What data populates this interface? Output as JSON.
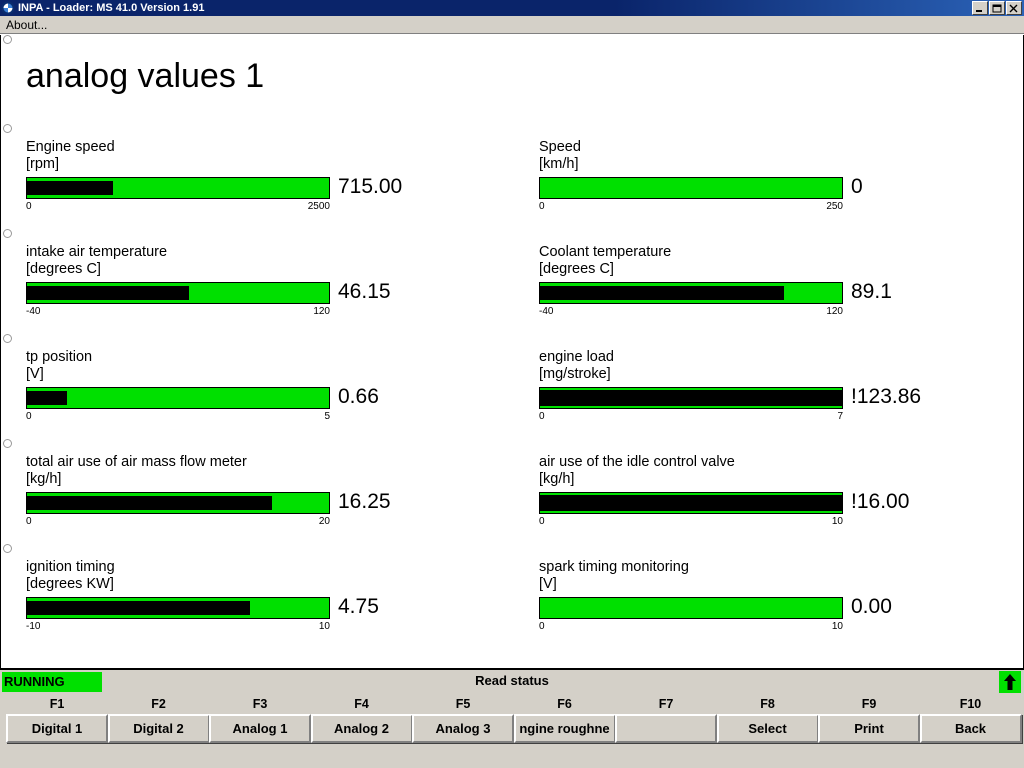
{
  "window": {
    "title": "INPA - Loader:  MS 41.0 Version 1.91",
    "icon": "bmw-roundel-icon",
    "minimize_label": "minimize-icon",
    "maximize_label": "maximize-icon",
    "close_label": "close-icon"
  },
  "menubar": {
    "items": [
      {
        "label": "About..."
      }
    ]
  },
  "page": {
    "title": "analog values 1"
  },
  "gauges": [
    {
      "name": "Engine speed",
      "unit": "[rpm]",
      "value": "715.00",
      "min_label": "0",
      "max_label": "2500",
      "min": 0,
      "max": 2500,
      "numeric": 715.0,
      "fill_percent": 28.6,
      "over_range": false
    },
    {
      "name": "Speed",
      "unit": "[km/h]",
      "value": "0",
      "min_label": "0",
      "max_label": "250",
      "min": 0,
      "max": 250,
      "numeric": 0,
      "fill_percent": 0,
      "over_range": false
    },
    {
      "name": "intake air temperature",
      "unit": "[degrees C]",
      "value": "46.15",
      "min_label": "-40",
      "max_label": "120",
      "min": -40,
      "max": 120,
      "numeric": 46.15,
      "fill_percent": 53.8,
      "over_range": false
    },
    {
      "name": "Coolant temperature",
      "unit": "[degrees C]",
      "value": "89.1",
      "min_label": "-40",
      "max_label": "120",
      "min": -40,
      "max": 120,
      "numeric": 89.1,
      "fill_percent": 80.7,
      "over_range": false
    },
    {
      "name": "tp position",
      "unit": "[V]",
      "value": "0.66",
      "min_label": "0",
      "max_label": "5",
      "min": 0,
      "max": 5,
      "numeric": 0.66,
      "fill_percent": 13.2,
      "over_range": false
    },
    {
      "name": "engine load",
      "unit": "[mg/stroke]",
      "value": "!123.86",
      "min_label": "0",
      "max_label": "7",
      "min": 0,
      "max": 7,
      "numeric": 123.86,
      "fill_percent": 100,
      "over_range": true
    },
    {
      "name": "total air use of air mass flow meter",
      "unit": "[kg/h]",
      "value": "16.25",
      "min_label": "0",
      "max_label": "20",
      "min": 0,
      "max": 20,
      "numeric": 16.25,
      "fill_percent": 81.2,
      "over_range": false
    },
    {
      "name": "air use of the idle control valve",
      "unit": "[kg/h]",
      "value": "!16.00",
      "min_label": "0",
      "max_label": "10",
      "min": 0,
      "max": 10,
      "numeric": 16.0,
      "fill_percent": 100,
      "over_range": true
    },
    {
      "name": "ignition timing",
      "unit": "[degrees KW]",
      "value": "4.75",
      "min_label": "-10",
      "max_label": "10",
      "min": -10,
      "max": 10,
      "numeric": 4.75,
      "fill_percent": 73.8,
      "over_range": false
    },
    {
      "name": "spark timing monitoring",
      "unit": "[V]",
      "value": "0.00",
      "min_label": "0",
      "max_label": "10",
      "min": 0,
      "max": 10,
      "numeric": 0.0,
      "fill_percent": 0,
      "over_range": false
    }
  ],
  "statusbar": {
    "running_label": "RUNNING",
    "center_label": "Read status",
    "scroll_up_icon": "arrow-up-icon"
  },
  "function_keys": [
    {
      "key": "F1",
      "label": "Digital 1"
    },
    {
      "key": "F2",
      "label": "Digital 2"
    },
    {
      "key": "F3",
      "label": "Analog 1"
    },
    {
      "key": "F4",
      "label": "Analog 2"
    },
    {
      "key": "F5",
      "label": "Analog 3"
    },
    {
      "key": "F6",
      "label": "ngine roughne"
    },
    {
      "key": "F7",
      "label": ""
    },
    {
      "key": "F8",
      "label": "Select"
    },
    {
      "key": "F9",
      "label": "Print"
    },
    {
      "key": "F10",
      "label": "Back"
    }
  ],
  "colors": {
    "bar_green": "#00e000",
    "bar_fill": "#000000",
    "titlebar_blue": "#0a246a",
    "chrome": "#d4d0c8"
  },
  "anchor_dots": [
    6,
    4
  ]
}
